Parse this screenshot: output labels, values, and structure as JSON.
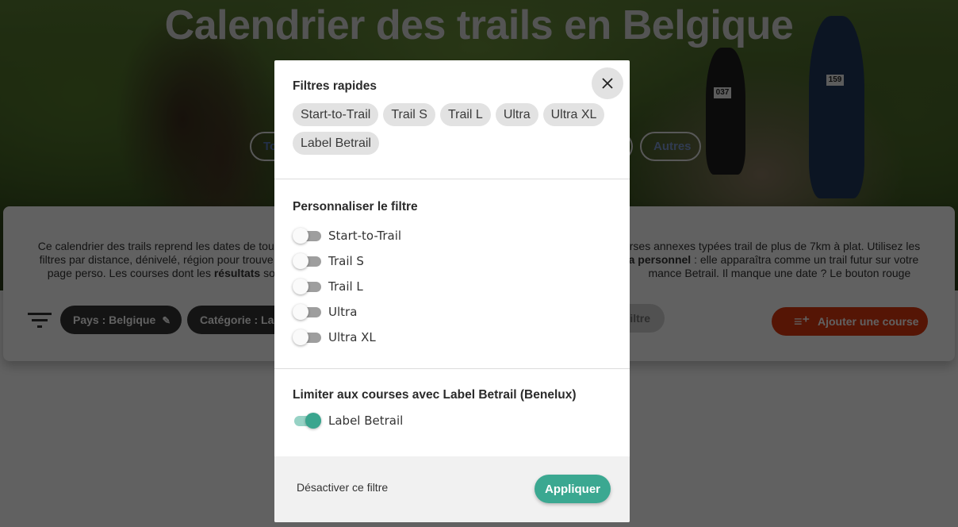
{
  "page": {
    "hero_title": "Calendrier des trails en Belgique",
    "hero_pills": {
      "first_partial": "To",
      "last": "Autres"
    },
    "description": {
      "line1_left": "Ce calendrier des trails reprend les dates de tou",
      "line1_right": "rses annexes typées trail de plus de 7km à plat. Utilisez les",
      "line2_left": "filtres par distance, dénivelé, région pour trouve",
      "line2_right_bold": "a personnel",
      "line2_right": " : elle apparaîtra comme un trail futur sur votre",
      "line3_left": "page perso. Les courses dont les ",
      "line3_left_bold": "résultats",
      "line3_left_after": " sont c",
      "line3_right": "mance Betrail. Il manque une date ? Le bouton rouge permet"
    },
    "filter_chips": [
      {
        "label": "Pays : Belgique",
        "icon": "pencil-icon"
      },
      {
        "label": "Catégorie : Lab"
      }
    ],
    "grey_chip_partial": "iltre",
    "add_course_button": {
      "label": "Ajouter une course",
      "icon": "playlist-add-icon"
    },
    "colors": {
      "add_button": "#e0380f"
    }
  },
  "modal": {
    "quick_filters": {
      "title": "Filtres rapides",
      "chips": [
        "Start-to-Trail",
        "Trail S",
        "Trail L",
        "Ultra",
        "Ultra XL",
        "Label Betrail"
      ]
    },
    "close_icon": "close-icon",
    "custom_filter": {
      "title": "Personnaliser le filtre",
      "toggles": [
        {
          "label": "Start-to-Trail",
          "checked": false
        },
        {
          "label": "Trail S",
          "checked": false
        },
        {
          "label": "Trail L",
          "checked": false
        },
        {
          "label": "Ultra",
          "checked": false
        },
        {
          "label": "Ultra XL",
          "checked": false
        }
      ]
    },
    "label_filter": {
      "title": "Limiter aux courses avec Label Betrail (Benelux)",
      "toggle": {
        "label": "Label Betrail",
        "checked": true
      }
    },
    "footer": {
      "deactivate_label": "Désactiver ce filtre",
      "apply_label": "Appliquer"
    },
    "colors": {
      "accent": "#3ba891",
      "accent_light": "#97d2c5"
    }
  }
}
